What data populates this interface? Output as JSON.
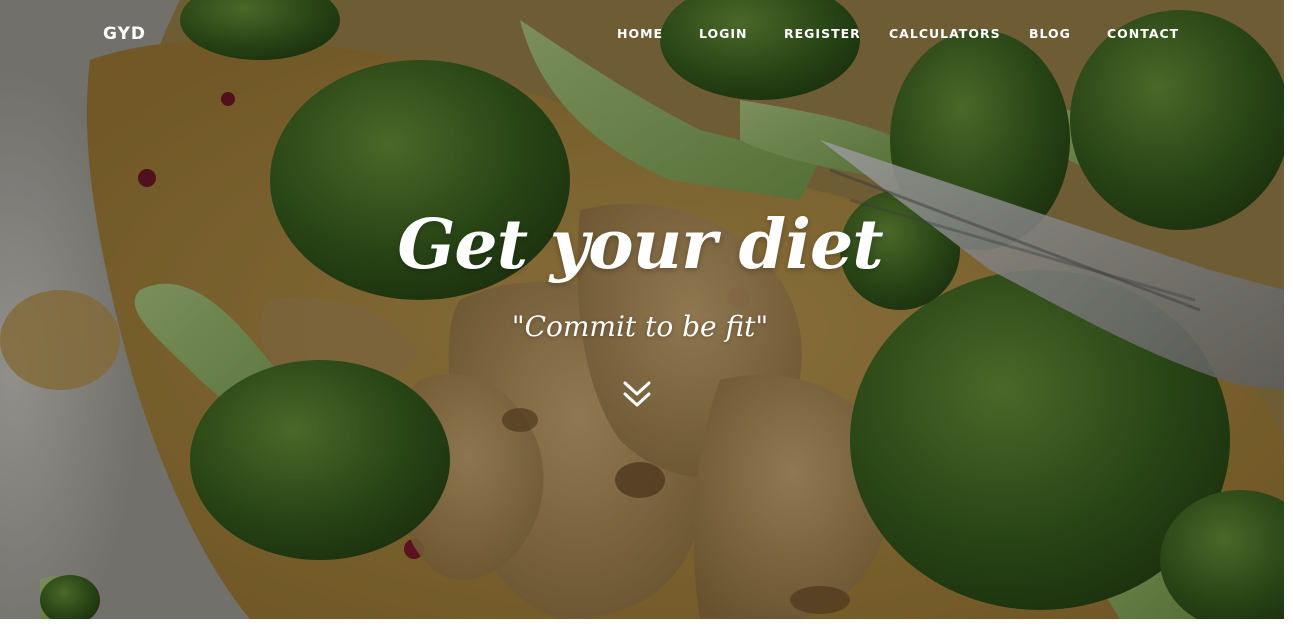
{
  "brand": {
    "name": "GYD"
  },
  "nav": {
    "items": [
      {
        "label": "HOME"
      },
      {
        "label": "LOGIN"
      },
      {
        "label": "REGISTER"
      },
      {
        "label": "CALCULATORS"
      },
      {
        "label": "BLOG"
      },
      {
        "label": "CONTACT"
      }
    ]
  },
  "hero": {
    "title": "Get your diet",
    "tagline": "\"Commit to be fit\"",
    "scroll_icon": "double-chevron-down-icon",
    "background": "food-photo-broccoli-chicken"
  },
  "colors": {
    "text": "#ffffff",
    "broccoli": "#4a7a2a",
    "sauce": "#b8923f",
    "overlay": "#000000"
  }
}
